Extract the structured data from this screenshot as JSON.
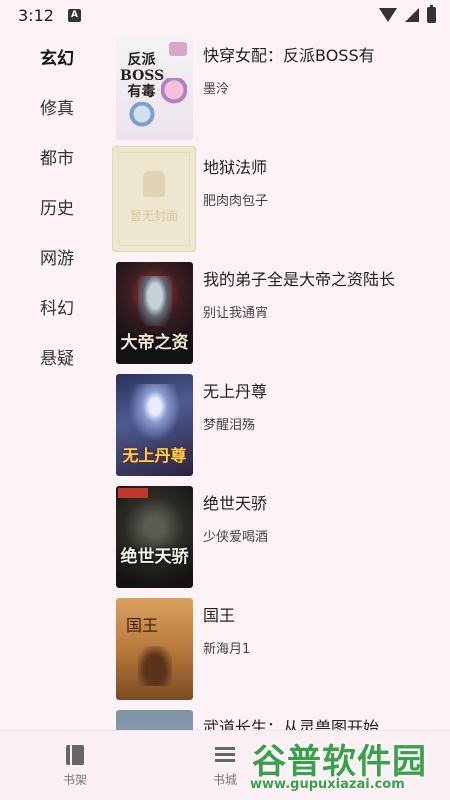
{
  "status_bar": {
    "time": "3:12",
    "indicator": "A"
  },
  "sidebar": {
    "items": [
      {
        "label": "玄幻",
        "active": true
      },
      {
        "label": "修真",
        "active": false
      },
      {
        "label": "都市",
        "active": false
      },
      {
        "label": "历史",
        "active": false
      },
      {
        "label": "网游",
        "active": false
      },
      {
        "label": "科幻",
        "active": false
      },
      {
        "label": "悬疑",
        "active": false
      }
    ]
  },
  "books": [
    {
      "title": "快穿女配：反派BOSS有",
      "author": "墨泠",
      "cover_text": "反派BOSS有毒"
    },
    {
      "title": "地狱法师",
      "author": "肥肉肉包子",
      "cover_text": "暂无封面"
    },
    {
      "title": "我的弟子全是大帝之资陆长",
      "author": "别让我通宵",
      "cover_text": "大帝之资"
    },
    {
      "title": "无上丹尊",
      "author": "梦醒泪殇",
      "cover_text": "无上丹尊"
    },
    {
      "title": "绝世天骄",
      "author": "少侠爱喝酒",
      "cover_text": "绝世天骄"
    },
    {
      "title": "国王",
      "author": "新海月1",
      "cover_text": "国王"
    },
    {
      "title": "武道长生：从灵兽图开始",
      "author": "",
      "cover_text": ""
    }
  ],
  "bottom_nav": {
    "tabs": [
      {
        "label": "书架",
        "icon": "book-icon"
      },
      {
        "label": "书城",
        "icon": "list-icon"
      }
    ]
  },
  "watermark": {
    "title": "谷普软件园",
    "url": "www.gupuxiazai.com"
  }
}
